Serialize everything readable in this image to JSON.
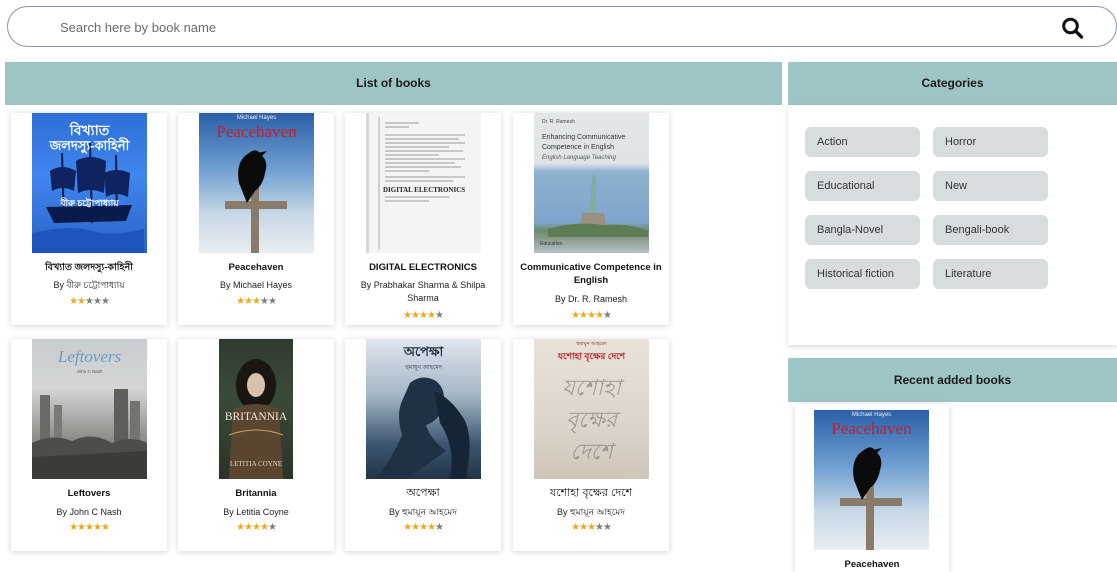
{
  "search": {
    "placeholder": "Search here by book name",
    "icon": "search-icon"
  },
  "books_panel": {
    "title": "List of books"
  },
  "books": [
    {
      "title": "বিখ্যাত জলদস্যু-কাহিনী",
      "author": "By বীরু চট্টোপাধ্যায়",
      "rating": 2,
      "cover_text": [
        "বিখ্যাত",
        "জলদস্যু-কাহিনী",
        "বীরু চট্টোপাধ্যায়"
      ]
    },
    {
      "title": "Peacehaven",
      "author": "By Michael Hayes",
      "rating": 3,
      "cover_text": [
        "Michael Hayes",
        "Peacehaven"
      ]
    },
    {
      "title": "DIGITAL ELECTRONICS",
      "author": "By Prabhakar Sharma & Shilpa Sharma",
      "rating": 4,
      "cover_text": [
        "DIGITAL ELECTRONICS"
      ]
    },
    {
      "title": "Communicative Competence in English",
      "author": "By Dr. R. Ramesh",
      "rating": 4,
      "cover_text": [
        "Dr. R. Ramesh",
        "Enhancing Communicative Competence in English",
        "English Language Teaching",
        "Education"
      ]
    },
    {
      "title": "Leftovers",
      "author": "By John C Nash",
      "rating": 5,
      "cover_text": [
        "Leftovers",
        "John C Nash"
      ]
    },
    {
      "title": "Britannia",
      "author": "By Letitia Coyne",
      "rating": 4,
      "cover_text": [
        "BRITANNIA",
        "LETITIA COYNE"
      ]
    },
    {
      "title": "অপেক্ষা",
      "author": "By হুমায়ূন আহমেদ",
      "rating": 4,
      "cover_text": [
        "অপেক্ষা",
        "হুমায়ূন আহমেদ"
      ]
    },
    {
      "title": "যশোহা বৃক্ষের দেশে",
      "author": "By হুমায়ূন আহমেদ",
      "rating": 3,
      "cover_text": [
        "হুমায়ূন আহমেদ",
        "যশোহা বৃক্ষের দেশে",
        "যশোহা",
        "বৃক্ষের",
        "দেশে"
      ]
    }
  ],
  "categories_panel": {
    "title": "Categories"
  },
  "categories": [
    "Action",
    "Horror",
    "Educational",
    "New",
    "Bangla-Novel",
    "Bengali-book",
    "Historical fiction",
    "Literature"
  ],
  "recent_panel": {
    "title": "Recent added books"
  },
  "recent": [
    {
      "title": "Peacehaven",
      "cover_text": [
        "Michael Hayes",
        "Peacehaven"
      ]
    }
  ],
  "colors": {
    "header_bg": "#9ec4c6",
    "chip_bg": "#d7dcdf",
    "star_on": "#f0a91e",
    "star_off": "#7f7f7f"
  }
}
